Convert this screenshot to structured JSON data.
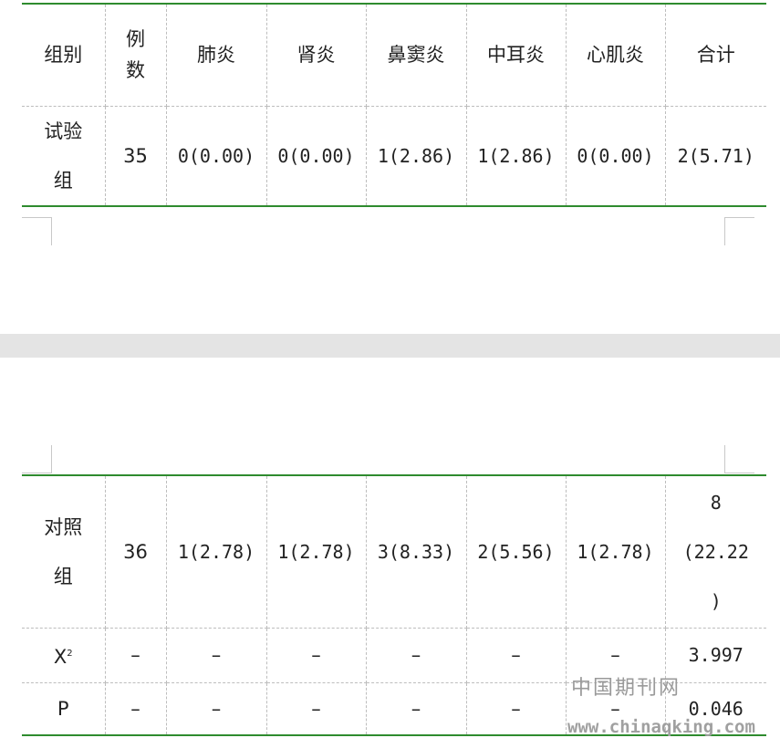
{
  "header": {
    "group": "组别",
    "cases_line1": "例",
    "cases_line2": "数",
    "c1": "肺炎",
    "c2": "肾炎",
    "c3": "鼻窦炎",
    "c4": "中耳炎",
    "c5": "心肌炎",
    "total": "合计"
  },
  "trial": {
    "group_line1": "试验",
    "group_line2": "组",
    "n": "35",
    "values": [
      "0(0.00)",
      "0(0.00)",
      "1(2.86)",
      "1(2.86)",
      "0(0.00)"
    ],
    "total": "2(5.71)"
  },
  "control": {
    "group_line1": "对照",
    "group_line2": "组",
    "n": "36",
    "values": [
      "1(2.78)",
      "1(2.78)",
      "3(8.33)",
      "2(5.56)",
      "1(2.78)"
    ],
    "total_line1": "8",
    "total_line2": "(22.22",
    "total_line3": ")"
  },
  "chi": {
    "label": "X",
    "sup": "2",
    "dashes": [
      "–",
      "–",
      "–",
      "–",
      "–",
      "–"
    ],
    "total": "3.997"
  },
  "p": {
    "label": "P",
    "dashes": [
      "–",
      "–",
      "–",
      "–",
      "–",
      "–"
    ],
    "total": "0.046"
  },
  "watermark": {
    "cn": "中国期刊网",
    "url": "www.chinaqking.com"
  }
}
